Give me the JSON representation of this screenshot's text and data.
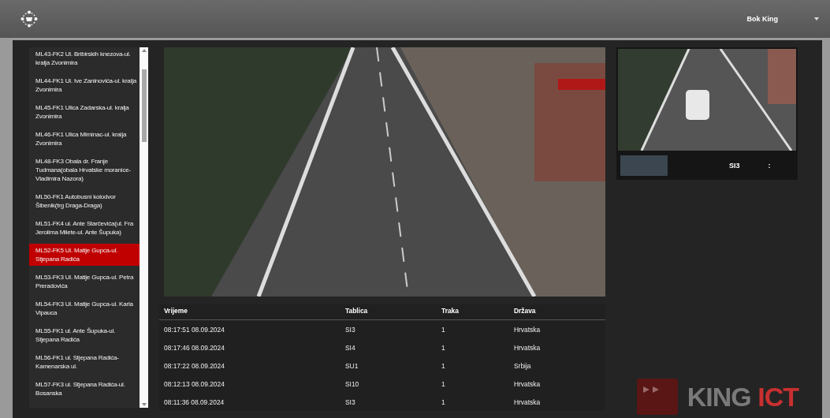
{
  "header": {
    "user_menu": {
      "label": "Bok King"
    }
  },
  "locations": [
    {
      "label": "ML43-FK2 Ul. Bribirskih knezova-ul. kralja Zvonimira",
      "selected": false
    },
    {
      "label": "ML44-FK1 Ul. Ive Zaninovića-ul. kralja Zvonimira",
      "selected": false
    },
    {
      "label": "ML45-FK1 Ulica Zadarska-ul. kralja Zvonimira",
      "selected": false
    },
    {
      "label": "ML46-FK1 Ulica Miminac-ul. kralja Zvonimira",
      "selected": false
    },
    {
      "label": "ML48-FK3 Obala dr. Franje Tudmana(obala Hrvatske moranice-Vladimira Nazora)",
      "selected": false
    },
    {
      "label": "ML50-FK1 Autobusni kolodvor Šibenik(trg Draga-Draga)",
      "selected": false
    },
    {
      "label": "ML51-FK4 ul. Ante Starčevića(ul. Fra Jerolima Milete-ul. Ante Šupuka)",
      "selected": false
    },
    {
      "label": "ML52-FK5 Ul. Matije Gupca-ul. Stjepana Radića",
      "selected": true
    },
    {
      "label": "ML53-FK3 Ul. Matije Gupca-ul. Petra Preradovića",
      "selected": false
    },
    {
      "label": "ML54-FK3 Ul. Matije Gupca-ul. Karla Vipauca",
      "selected": false
    },
    {
      "label": "ML55-FK1 ul. Ante Šupuka-ul. Stjepana Radića",
      "selected": false
    },
    {
      "label": "ML56-FK1 ul. Stjepana Radića-Kamenarska ul.",
      "selected": false
    },
    {
      "label": "ML57-FK3 ul. Stjepana Radića-ul. Bosanska",
      "selected": false
    }
  ],
  "detections": {
    "columns": [
      "Vrijeme",
      "Tablica",
      "Traka",
      "Država"
    ],
    "rows": [
      [
        "08:17:51 08.09.2024",
        "SI3",
        "1",
        "Hrvatska"
      ],
      [
        "08:17:46 08.09.2024",
        "SI4",
        "1",
        "Hrvatska"
      ],
      [
        "08:17:22 08.09.2024",
        "SU1",
        "1",
        "Srbija"
      ],
      [
        "08:12:13 08.09.2024",
        "SI10",
        "1",
        "Hrvatska"
      ],
      [
        "08:11:36 08.09.2024",
        "SI3",
        "1",
        "Hrvatska"
      ]
    ]
  },
  "last_capture": {
    "plate_text": "SI3",
    "mark": ":"
  },
  "brand": {
    "name": "KING",
    "accent": "ICT"
  }
}
